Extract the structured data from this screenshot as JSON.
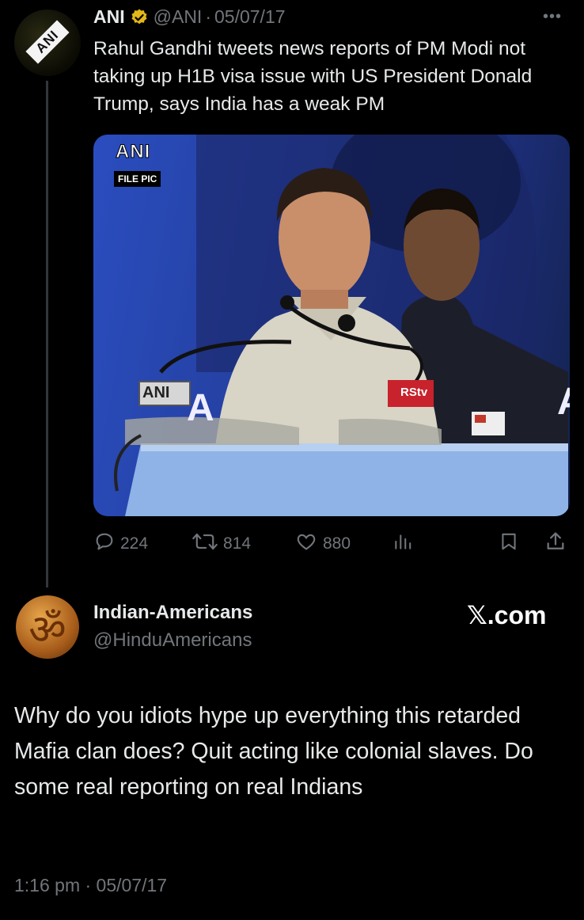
{
  "original_tweet": {
    "author_name": "ANI",
    "handle": "@ANI",
    "separator": "·",
    "date": "05/07/17",
    "more": "•••",
    "text": "Rahul Gandhi tweets news reports of PM Modi not taking up H1B visa issue with US President Donald Trump, says India has a weak PM",
    "avatar_text": "ANI",
    "media": {
      "logo": "ANI",
      "tag": "FILE PIC",
      "mic_label_left": "ANI",
      "mic_label_right": "RStv",
      "banner_left": "A",
      "banner_right": "A"
    },
    "stats": {
      "replies": "224",
      "retweets": "814",
      "likes": "880"
    }
  },
  "reply": {
    "author_name": "Indian-Americans",
    "handle": "@HinduAmericans",
    "watermark": "𝕏.com",
    "text": "Why do you idiots hype up everything this retarded Mafia clan does? Quit acting like colonial slaves. Do some real reporting on real Indians",
    "avatar_symbol": "ॐ",
    "timestamp": "1:16 pm · 05/07/17"
  },
  "colors": {
    "background": "#000000",
    "text": "#e7e9ea",
    "secondary": "#71767b",
    "verified_gold": "#e2b719"
  },
  "icons": [
    "reply-icon",
    "retweet-icon",
    "like-icon",
    "views-icon",
    "bookmark-icon",
    "share-icon",
    "verified-badge-icon",
    "more-icon"
  ]
}
